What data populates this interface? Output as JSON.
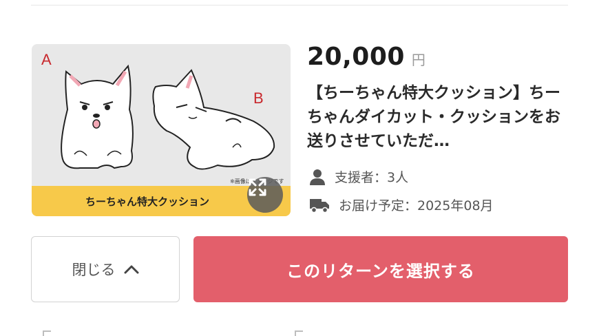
{
  "reward": {
    "price_amount": "20,000",
    "price_unit": "円",
    "title": "【ちーちゃん特大クッション】ちーちゃんダイカット・クッションをお送りさせていただ…",
    "supporters_text": "支援者：3人",
    "delivery_text": "お届け予定：2025年08月"
  },
  "thumbnail": {
    "label_a": "A",
    "label_b": "B",
    "note": "※画像はイメージです",
    "banner": "ちーちゃん特大クッション",
    "banner_color": "#f7c94a",
    "expand_icon": "expand-icon"
  },
  "actions": {
    "close_label": "閉じる",
    "select_label": "このリターンを選択する",
    "select_color": "#e35f6b"
  }
}
